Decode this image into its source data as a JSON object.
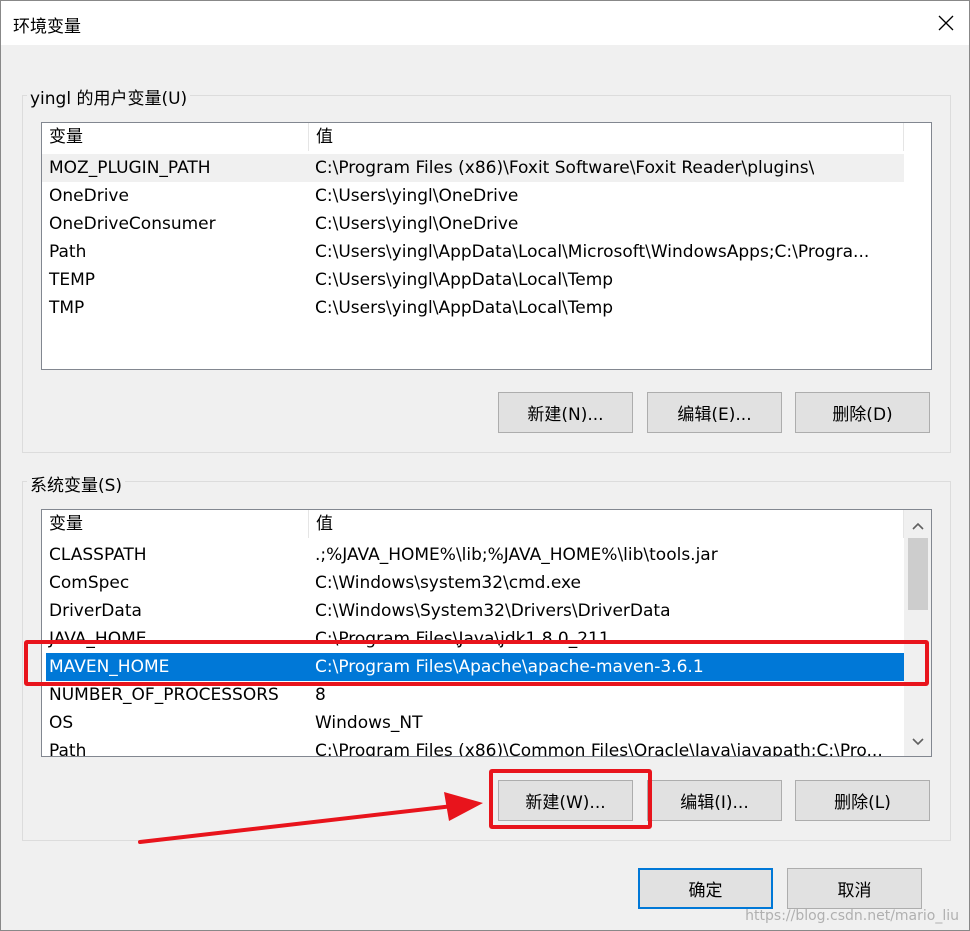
{
  "window": {
    "title": "环境变量"
  },
  "user_vars": {
    "group_label": "yingl 的用户变量(U)",
    "col_name": "变量",
    "col_value": "值",
    "rows": [
      {
        "name": "MOZ_PLUGIN_PATH",
        "value": "C:\\Program Files (x86)\\Foxit Software\\Foxit Reader\\plugins\\"
      },
      {
        "name": "OneDrive",
        "value": "C:\\Users\\yingl\\OneDrive"
      },
      {
        "name": "OneDriveConsumer",
        "value": "C:\\Users\\yingl\\OneDrive"
      },
      {
        "name": "Path",
        "value": "C:\\Users\\yingl\\AppData\\Local\\Microsoft\\WindowsApps;C:\\Progra..."
      },
      {
        "name": "TEMP",
        "value": "C:\\Users\\yingl\\AppData\\Local\\Temp"
      },
      {
        "name": "TMP",
        "value": "C:\\Users\\yingl\\AppData\\Local\\Temp"
      }
    ],
    "new_label": "新建(N)...",
    "edit_label": "编辑(E)...",
    "delete_label": "删除(D)"
  },
  "sys_vars": {
    "group_label": "系统变量(S)",
    "col_name": "变量",
    "col_value": "值",
    "rows": [
      {
        "name": "CLASSPATH",
        "value": ".;%JAVA_HOME%\\lib;%JAVA_HOME%\\lib\\tools.jar"
      },
      {
        "name": "ComSpec",
        "value": "C:\\Windows\\system32\\cmd.exe"
      },
      {
        "name": "DriverData",
        "value": "C:\\Windows\\System32\\Drivers\\DriverData"
      },
      {
        "name": "JAVA_HOME",
        "value": "C:\\Program Files\\Java\\jdk1.8.0_211"
      },
      {
        "name": "MAVEN_HOME",
        "value": "C:\\Program Files\\Apache\\apache-maven-3.6.1"
      },
      {
        "name": "NUMBER_OF_PROCESSORS",
        "value": "8"
      },
      {
        "name": "OS",
        "value": "Windows_NT"
      },
      {
        "name": "Path",
        "value": "C:\\Program Files (x86)\\Common Files\\Oracle\\Java\\javapath;C:\\Pro..."
      }
    ],
    "selected_index": 4,
    "new_label": "新建(W)...",
    "edit_label": "编辑(I)...",
    "delete_label": "删除(L)"
  },
  "footer": {
    "ok_label": "确定",
    "cancel_label": "取消"
  },
  "watermark": "https://blog.csdn.net/mario_liu",
  "colors": {
    "selection": "#0078d7",
    "annotation": "#e8141c"
  },
  "icons": {
    "close": "close-icon",
    "scroll_up": "chevron-up-icon",
    "scroll_down": "chevron-down-icon"
  }
}
